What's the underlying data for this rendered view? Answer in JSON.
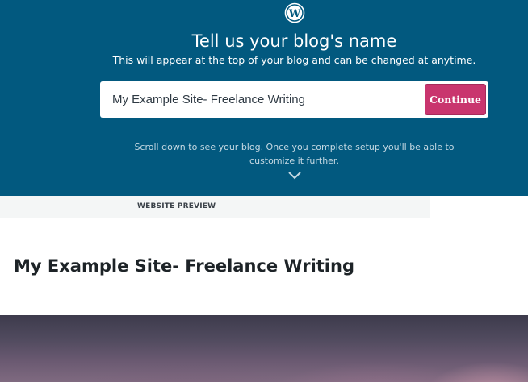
{
  "header": {
    "logo_icon": "wordpress-logo-icon",
    "title": "Tell us your blog's name",
    "subtitle": "This will appear at the top of your blog and can be changed at anytime.",
    "blog_name_input": {
      "value": "My Example Site- Freelance Writing"
    },
    "continue_label": "Continue",
    "scroll_note_line1": "Scroll down to see your blog. Once you complete setup you'll be able to",
    "scroll_note_line2": "customize it further.",
    "scroll_icon": "chevron-down-icon"
  },
  "preview": {
    "label": "WEBSITE PREVIEW",
    "site_title": "My Example Site- Freelance Writing"
  },
  "colors": {
    "header_bg": "#02597f",
    "accent_button": "#c9356e"
  }
}
